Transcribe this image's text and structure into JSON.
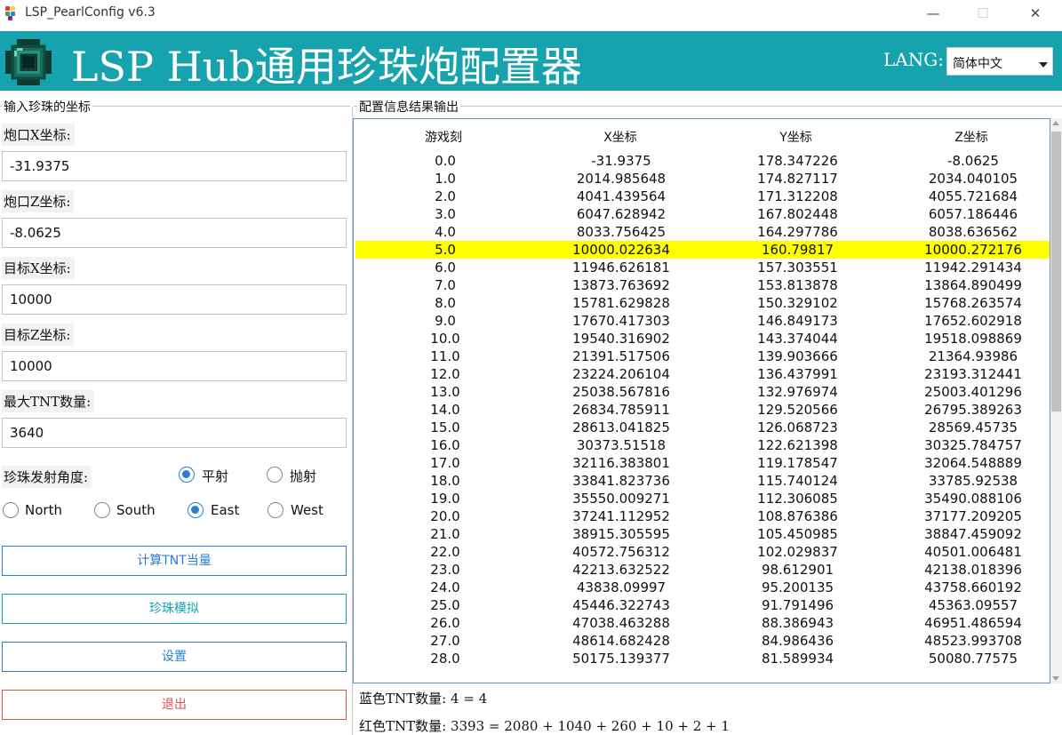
{
  "window": {
    "title": "LSP_PearlConfig v6.3",
    "minimize": "—",
    "maximize": "☐",
    "close": "✕"
  },
  "banner": {
    "title": "LSP Hub通用珍珠炮配置器",
    "lang_label": "LANG:",
    "lang_value": "简体中文",
    "color": "#17a3ad"
  },
  "input_panel": {
    "title": "输入珍珠的坐标",
    "fields": [
      {
        "label": "炮口X坐标:",
        "value": "-31.9375"
      },
      {
        "label": "炮口Z坐标:",
        "value": "-8.0625"
      },
      {
        "label": "目标X坐标:",
        "value": "10000"
      },
      {
        "label": "目标Z坐标:",
        "value": "10000"
      },
      {
        "label": "最大TNT数量:",
        "value": "3640"
      }
    ],
    "angle_label": "珍珠发射角度:",
    "angle_options": [
      {
        "label": "平射",
        "checked": true
      },
      {
        "label": "抛射",
        "checked": false
      }
    ],
    "direction_options": [
      {
        "label": "North",
        "checked": false
      },
      {
        "label": "South",
        "checked": false
      },
      {
        "label": "East",
        "checked": true
      },
      {
        "label": "West",
        "checked": false
      }
    ],
    "buttons": [
      {
        "label": "计算TNT当量",
        "color": "#2b7cd3"
      },
      {
        "label": "珍珠模拟",
        "color": "#17a3ad"
      },
      {
        "label": "设置",
        "color": "#2b7cd3"
      },
      {
        "label": "退出",
        "color": "#d9534f"
      }
    ]
  },
  "output_panel": {
    "title": "配置信息结果输出",
    "columns": [
      "游戏刻",
      "X坐标",
      "Y坐标",
      "Z坐标"
    ],
    "highlight_color": "#ffff00",
    "rows": [
      [
        "0.0",
        "-31.9375",
        "178.347226",
        "-8.0625"
      ],
      [
        "1.0",
        "2014.985648",
        "174.827117",
        "2034.040105"
      ],
      [
        "2.0",
        "4041.439564",
        "171.312208",
        "4055.721684"
      ],
      [
        "3.0",
        "6047.628942",
        "167.802448",
        "6057.186446"
      ],
      [
        "4.0",
        "8033.756425",
        "164.297786",
        "8038.636562"
      ],
      [
        "5.0",
        "10000.022634",
        "160.79817",
        "10000.272176"
      ],
      [
        "6.0",
        "11946.626181",
        "157.303551",
        "11942.291434"
      ],
      [
        "7.0",
        "13873.763692",
        "153.813878",
        "13864.890499"
      ],
      [
        "8.0",
        "15781.629828",
        "150.329102",
        "15768.263574"
      ],
      [
        "9.0",
        "17670.417303",
        "146.849173",
        "17652.602918"
      ],
      [
        "10.0",
        "19540.316902",
        "143.374044",
        "19518.098869"
      ],
      [
        "11.0",
        "21391.517506",
        "139.903666",
        "21364.93986"
      ],
      [
        "12.0",
        "23224.206104",
        "136.437991",
        "23193.312441"
      ],
      [
        "13.0",
        "25038.567816",
        "132.976974",
        "25003.401296"
      ],
      [
        "14.0",
        "26834.785911",
        "129.520566",
        "26795.389263"
      ],
      [
        "15.0",
        "28613.041825",
        "126.068723",
        "28569.45735"
      ],
      [
        "16.0",
        "30373.51518",
        "122.621398",
        "30325.784757"
      ],
      [
        "17.0",
        "32116.383801",
        "119.178547",
        "32064.548889"
      ],
      [
        "18.0",
        "33841.823736",
        "115.740124",
        "33785.92538"
      ],
      [
        "19.0",
        "35550.009271",
        "112.306085",
        "35490.088106"
      ],
      [
        "20.0",
        "37241.112952",
        "108.876386",
        "37177.209205"
      ],
      [
        "21.0",
        "38915.305595",
        "105.450985",
        "38847.459092"
      ],
      [
        "22.0",
        "40572.756312",
        "102.029837",
        "40501.006481"
      ],
      [
        "23.0",
        "42213.632522",
        "98.612901",
        "42138.018396"
      ],
      [
        "24.0",
        "43838.09997",
        "95.200135",
        "43758.660192"
      ],
      [
        "25.0",
        "45446.322743",
        "91.791496",
        "45363.09557"
      ],
      [
        "26.0",
        "47038.463288",
        "88.386943",
        "46951.486594"
      ],
      [
        "27.0",
        "48614.682428",
        "84.986436",
        "48523.993708"
      ],
      [
        "28.0",
        "50175.139377",
        "81.589934",
        "50080.77575"
      ]
    ],
    "highlighted_row": 5,
    "summary": [
      "蓝色TNT数量: 4 = 4",
      "红色TNT数量: 3393 = 2080 + 1040 + 260 + 10 + 2 + 1"
    ]
  }
}
